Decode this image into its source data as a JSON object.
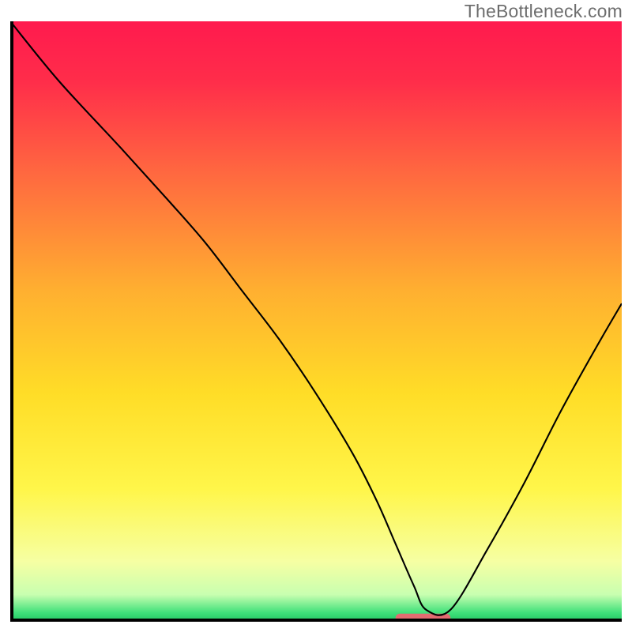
{
  "watermark": "TheBottleneck.com",
  "chart_data": {
    "type": "line",
    "title": "",
    "xlabel": "",
    "ylabel": "",
    "xlim": [
      0,
      100
    ],
    "ylim": [
      0,
      100
    ],
    "background": {
      "type": "vertical-gradient",
      "stops": [
        {
          "offset": 0.0,
          "color": "#ff1a4e"
        },
        {
          "offset": 0.1,
          "color": "#ff2d4a"
        },
        {
          "offset": 0.25,
          "color": "#ff6740"
        },
        {
          "offset": 0.45,
          "color": "#ffb030"
        },
        {
          "offset": 0.62,
          "color": "#ffdd27"
        },
        {
          "offset": 0.78,
          "color": "#fff64a"
        },
        {
          "offset": 0.9,
          "color": "#f6ffa3"
        },
        {
          "offset": 0.955,
          "color": "#c8ffb0"
        },
        {
          "offset": 0.985,
          "color": "#3fe07a"
        },
        {
          "offset": 1.0,
          "color": "#22c562"
        }
      ]
    },
    "series": [
      {
        "name": "bottleneck-curve",
        "color": "#000000",
        "stroke_width": 2.1,
        "x": [
          0,
          8,
          18,
          26,
          32,
          38,
          44,
          50,
          56,
          60,
          63,
          66,
          68,
          72,
          78,
          84,
          90,
          96,
          100
        ],
        "y": [
          100,
          90,
          79,
          70,
          63,
          55,
          47,
          38,
          28,
          20,
          13,
          6,
          2,
          2,
          12,
          23,
          35,
          46,
          53
        ]
      }
    ],
    "marker": {
      "name": "optimum-marker",
      "shape": "rounded-rect",
      "color": "#e26b71",
      "x_range": [
        63,
        72
      ],
      "y": 0.6,
      "height_pct": 1.5
    },
    "axes": {
      "show_frame": true,
      "frame_color": "#000000",
      "frame_width": 4,
      "show_ticks": false,
      "show_grid": false
    }
  }
}
